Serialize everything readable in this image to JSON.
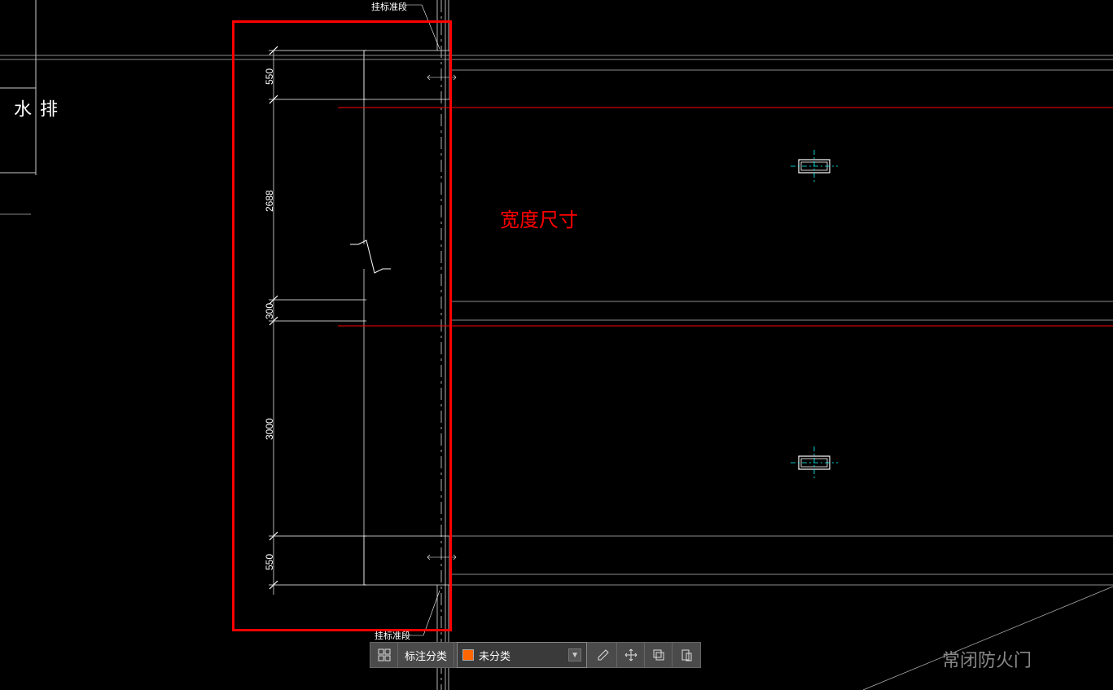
{
  "sidebar": {
    "label1": "排 水"
  },
  "annotation": {
    "width_label": "宽度尺寸"
  },
  "dimensions": {
    "d1": "550",
    "d2": "2688",
    "d3": "300",
    "d4": "3000",
    "d5": "550"
  },
  "top_labels": {
    "leader1": "挂标准段",
    "leader2": "挂标准段"
  },
  "toolbar": {
    "category_label": "标注分类",
    "category_value": "未分类"
  },
  "bottom_label": "常闭防火门"
}
